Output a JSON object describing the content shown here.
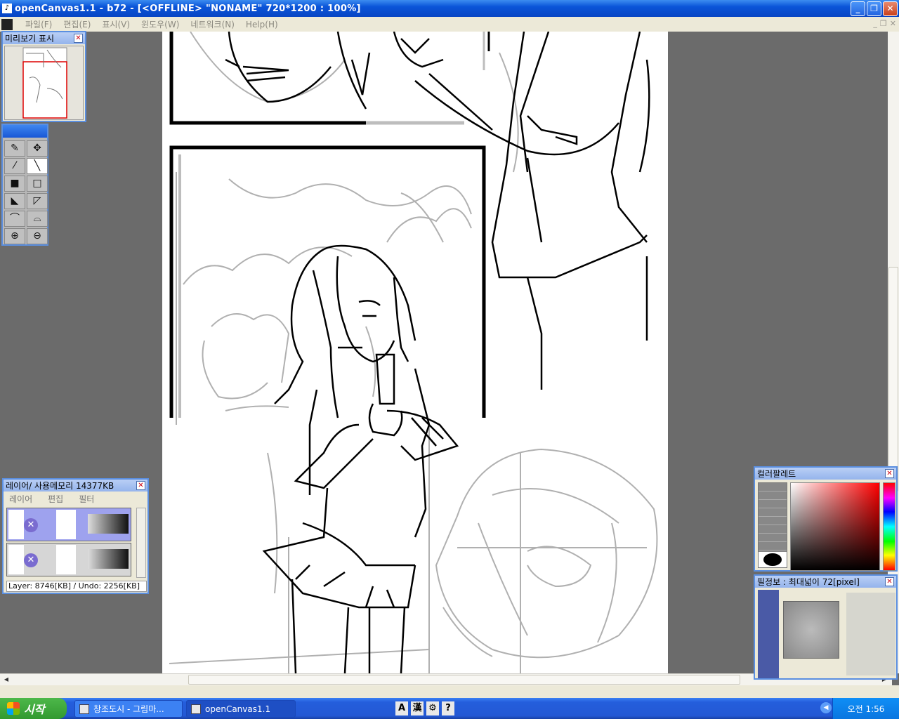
{
  "window": {
    "title": "openCanvas1.1 - b72 - [<OFFLINE>  \"NONAME\" 720*1200 : 100%]",
    "minimize": "_",
    "restore": "❐",
    "close": "✕"
  },
  "menu": {
    "items": [
      "파일(F)",
      "편집(E)",
      "표시(V)",
      "윈도우(W)",
      "네트워크(N)",
      "Help(H)"
    ],
    "mdi": [
      "_",
      "❐",
      "✕"
    ]
  },
  "preview_panel": {
    "title": "미리보기 표시",
    "close": "✕"
  },
  "toolbox": {
    "tools": [
      {
        "name": "pen-tool",
        "glyph": "✎"
      },
      {
        "name": "move-tool",
        "glyph": "✥"
      },
      {
        "name": "eyedropper-tool",
        "glyph": "⁄"
      },
      {
        "name": "line-tool",
        "glyph": "╲"
      },
      {
        "name": "black-fill-tool",
        "glyph": "■"
      },
      {
        "name": "white-fill-tool",
        "glyph": "□"
      },
      {
        "name": "lasso-fill-tool",
        "glyph": "◣"
      },
      {
        "name": "lasso-tool",
        "glyph": "◸"
      },
      {
        "name": "curve-tool",
        "glyph": "⌒"
      },
      {
        "name": "curve2-tool",
        "glyph": "⌓"
      },
      {
        "name": "zoom-in-tool",
        "glyph": "⊕"
      },
      {
        "name": "zoom-out-tool",
        "glyph": "⊖"
      }
    ]
  },
  "layers_panel": {
    "title": "레이어/ 사용메모리 14377KB",
    "close": "✕",
    "menu": [
      "레이어",
      "편집",
      "필터"
    ],
    "status": "Layer: 8746[KB] / Undo: 2256[KB]"
  },
  "color_palette": {
    "title": "컬러팔레트",
    "close": "✕"
  },
  "brush_panel": {
    "title": "필정보 : 최대넓이 72[pixel]",
    "close": "✕"
  },
  "taskbar": {
    "start": "시작",
    "tasks": [
      "창조도시 - 그림마...",
      "openCanvas1.1"
    ],
    "ime": [
      "A",
      "漢",
      "⚙",
      "?"
    ],
    "clock": "오전 1:56"
  },
  "colors": {
    "titlebar": "#0a54d8",
    "canvas_bg": "#6b6b6b",
    "panel_bg": "#ece9d8"
  }
}
